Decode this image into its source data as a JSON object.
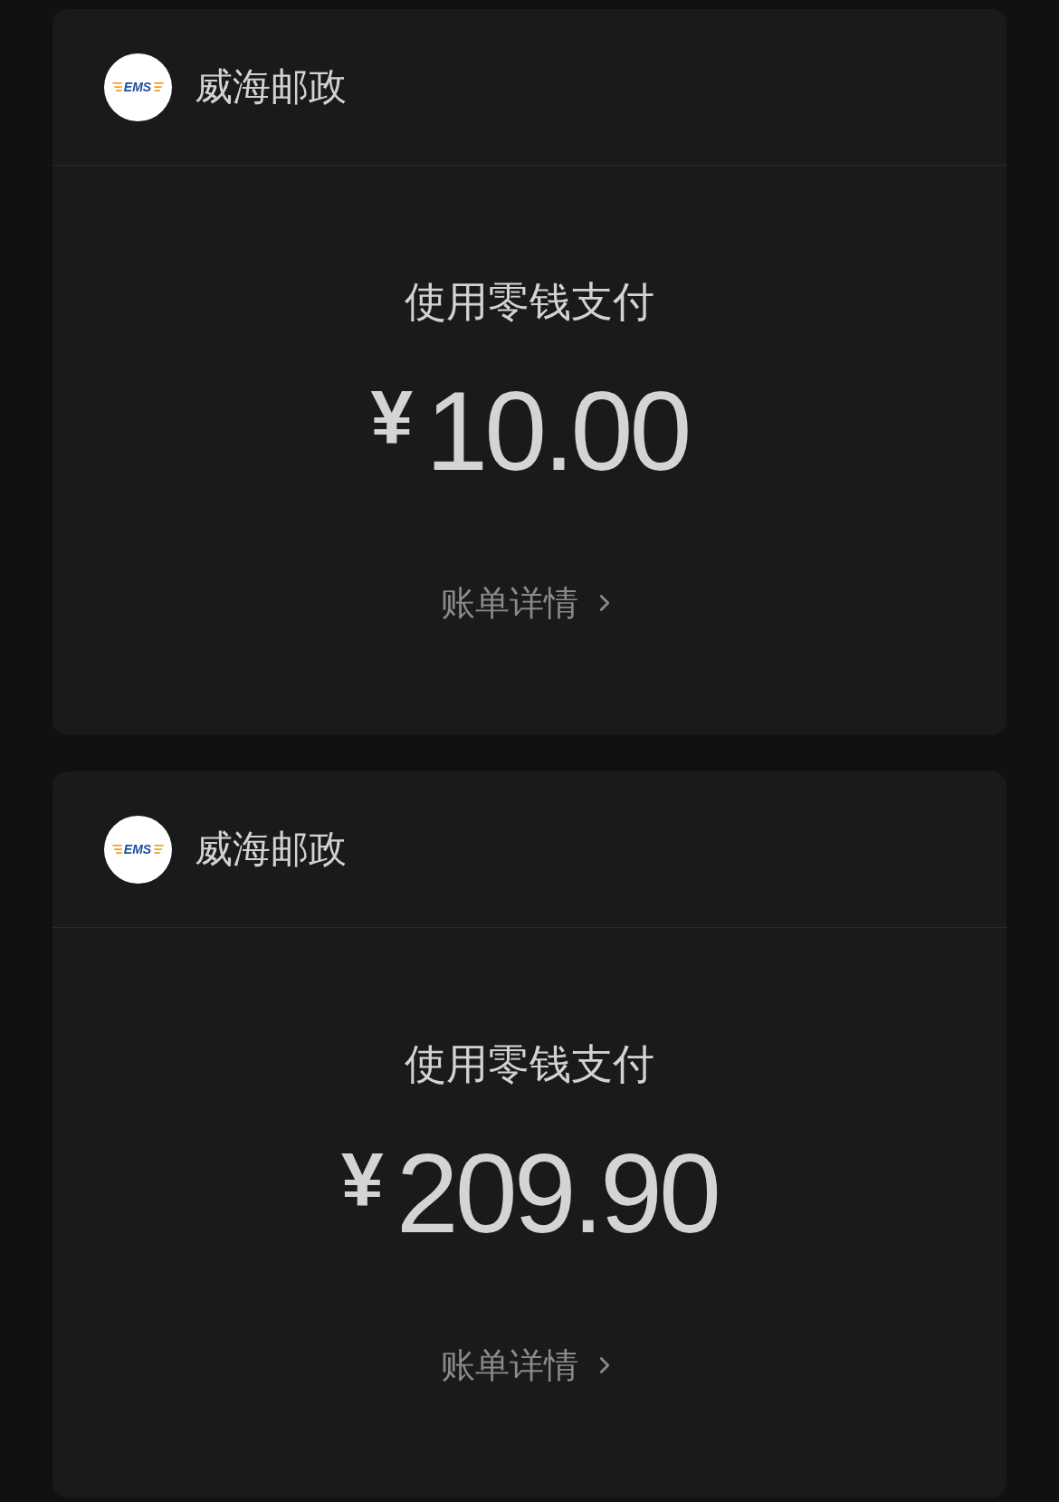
{
  "cards": [
    {
      "merchant": {
        "name": "威海邮政",
        "logo_text": "EMS"
      },
      "method": "使用零钱支付",
      "amount": {
        "currency": "¥",
        "value": "10.00"
      },
      "detail_link": {
        "label": "账单详情"
      }
    },
    {
      "merchant": {
        "name": "威海邮政",
        "logo_text": "EMS"
      },
      "method": "使用零钱支付",
      "amount": {
        "currency": "¥",
        "value": "209.90"
      },
      "detail_link": {
        "label": "账单详情"
      }
    }
  ]
}
